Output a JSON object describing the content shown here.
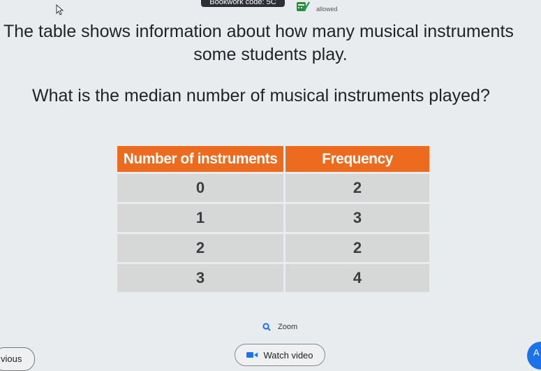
{
  "header": {
    "bookwork_code": "Bookwork code: 5C",
    "calculator_status": "allowed"
  },
  "question": {
    "intro_line1": "The table shows information about how many musical instruments",
    "intro_line2": "some students play.",
    "prompt": "What is the median number of musical instruments played?"
  },
  "table": {
    "headers": [
      "Number of instruments",
      "Frequency"
    ],
    "rows": [
      [
        "0",
        "2"
      ],
      [
        "1",
        "3"
      ],
      [
        "2",
        "2"
      ],
      [
        "3",
        "4"
      ]
    ],
    "header_color": "#ec6b1e",
    "cell_color": "#d6d8d8"
  },
  "footer": {
    "zoom_label": "Zoom",
    "previous_label": "vious",
    "watch_video_label": "Watch video",
    "answer_label": "A"
  }
}
